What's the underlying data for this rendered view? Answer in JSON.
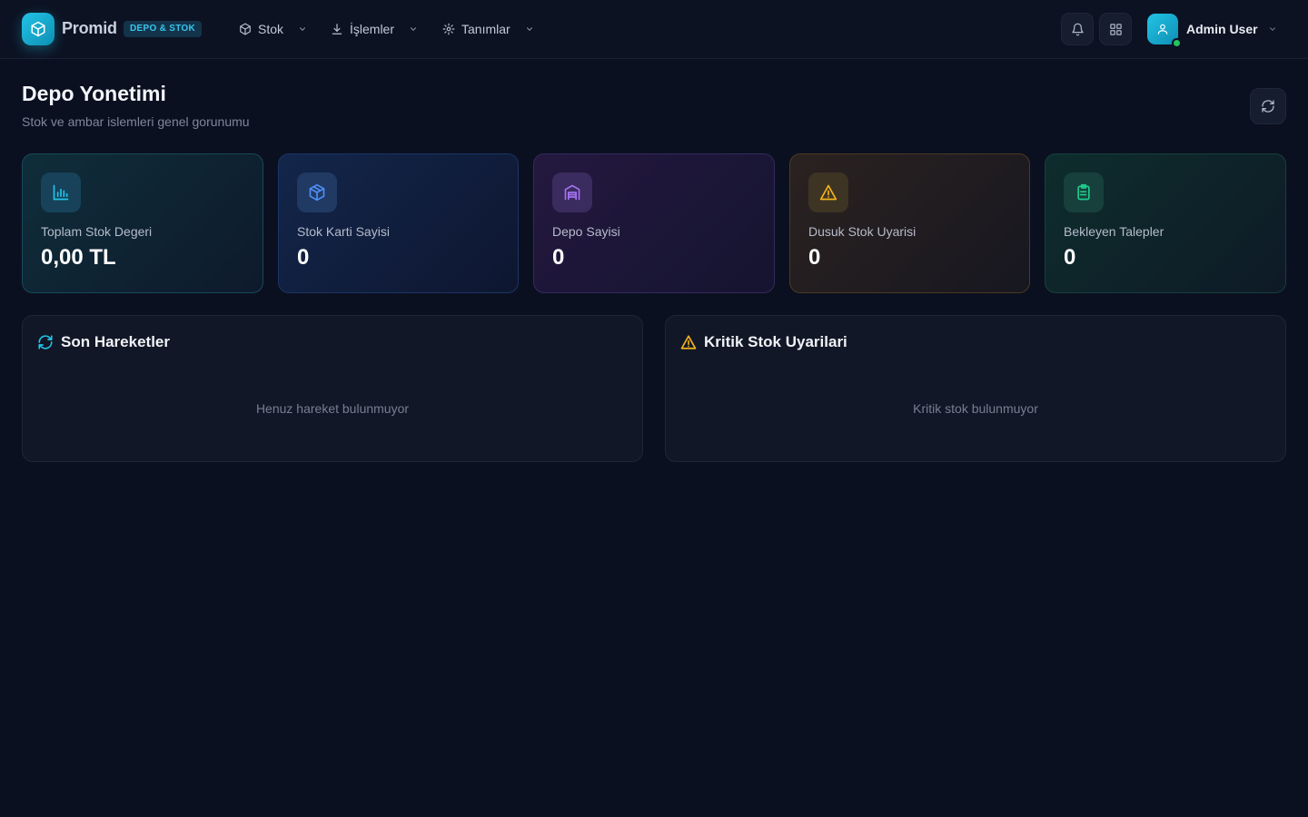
{
  "brand": {
    "name": "Promid",
    "badge": "DEPO & STOK",
    "accent": "#22c3e6"
  },
  "nav": {
    "items": [
      {
        "label": "Stok",
        "icon": "package-icon"
      },
      {
        "label": "İşlemler",
        "icon": "download-icon"
      },
      {
        "label": "Tanımlar",
        "icon": "gear-icon"
      }
    ]
  },
  "topbar": {
    "notification_icon": "bell-icon",
    "apps_icon": "grid-icon"
  },
  "user": {
    "name": "Admin User",
    "status_color": "#22c55e"
  },
  "header": {
    "title": "Depo Yonetimi",
    "subtitle": "Stok ve ambar islemleri genel gorunumu",
    "refresh_icon": "refresh-icon"
  },
  "stats": [
    {
      "label": "Toplam Stok Degeri",
      "value": "0,00 TL",
      "icon": "bar-chart-icon",
      "color": "#22c3e6"
    },
    {
      "label": "Stok Karti Sayisi",
      "value": "0",
      "icon": "package-icon",
      "color": "#4f8ff7"
    },
    {
      "label": "Depo Sayisi",
      "value": "0",
      "icon": "warehouse-icon",
      "color": "#a372f0"
    },
    {
      "label": "Dusuk Stok Uyarisi",
      "value": "0",
      "icon": "warning-icon",
      "color": "#f5b31b"
    },
    {
      "label": "Bekleyen Talepler",
      "value": "0",
      "icon": "clipboard-icon",
      "color": "#1fc98a"
    }
  ],
  "panels": {
    "recent": {
      "title": "Son Hareketler",
      "empty": "Henuz hareket bulunmuyor",
      "icon": "refresh-icon",
      "color": "#22c3e6"
    },
    "critical": {
      "title": "Kritik Stok Uyarilari",
      "empty": "Kritik stok bulunmuyor",
      "icon": "warning-icon",
      "color": "#f5b31b"
    }
  }
}
